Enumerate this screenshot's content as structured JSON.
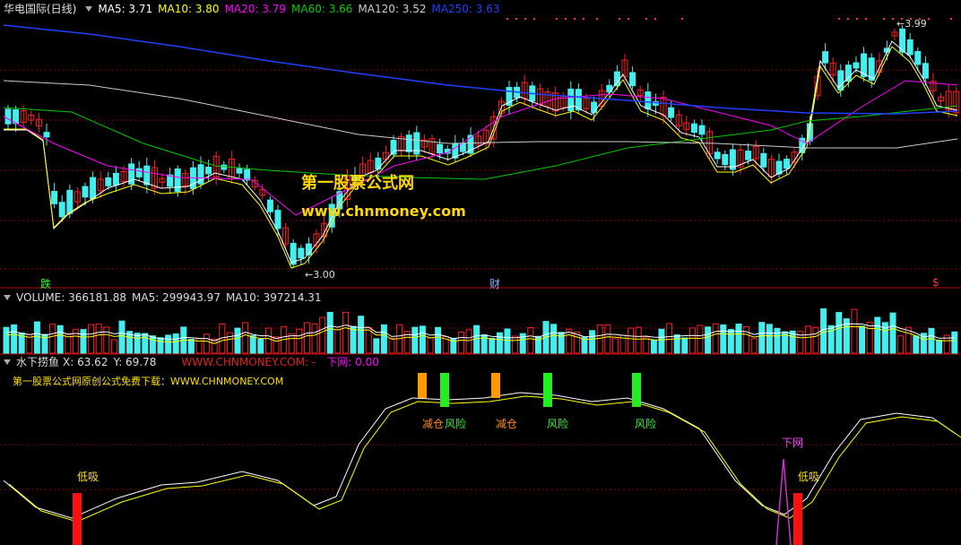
{
  "main": {
    "stock_title": "华电国际(日线)",
    "ma": [
      {
        "label": "MA5: 3.71",
        "color": "#ffffff"
      },
      {
        "label": "MA10: 3.80",
        "color": "#ffff00"
      },
      {
        "label": "MA20: 3.79",
        "color": "#ff00ff"
      },
      {
        "label": "MA60: 3.66",
        "color": "#00cc00"
      },
      {
        "label": "MA120: 3.52",
        "color": "#cccccc"
      },
      {
        "label": "MA250: 3.63",
        "color": "#2040ff"
      }
    ],
    "high_label": "3.99",
    "low_label": "3.00",
    "marks": {
      "die": "跌",
      "cai": "财",
      "dollar": "$"
    }
  },
  "watermark": {
    "line1": "第一股票公式网",
    "line2": "www.chnmoney.com"
  },
  "volume": {
    "label": "VOLUME: 366181.88",
    "ma5": "MA5: 299943.97",
    "ma10": "MA10: 397214.31"
  },
  "indicator": {
    "name": "水下捞鱼",
    "x": "X: 63.62",
    "y": "Y: 69.78",
    "site": "WWW.CHNMONEY.COM: -",
    "xiawang_value": "下网: 0.00",
    "promo": "第一股票公式网原创公式免费下载：WWW.CHNMONEY.COM",
    "signals": {
      "jiancang": "减仓",
      "fengxian": "风险",
      "dixi": "低吸",
      "xiawang": "下网"
    }
  },
  "colors": {
    "up": "#ff2020",
    "down": "#44eeee",
    "grid": "#8b0000",
    "border": "#b00000"
  }
}
